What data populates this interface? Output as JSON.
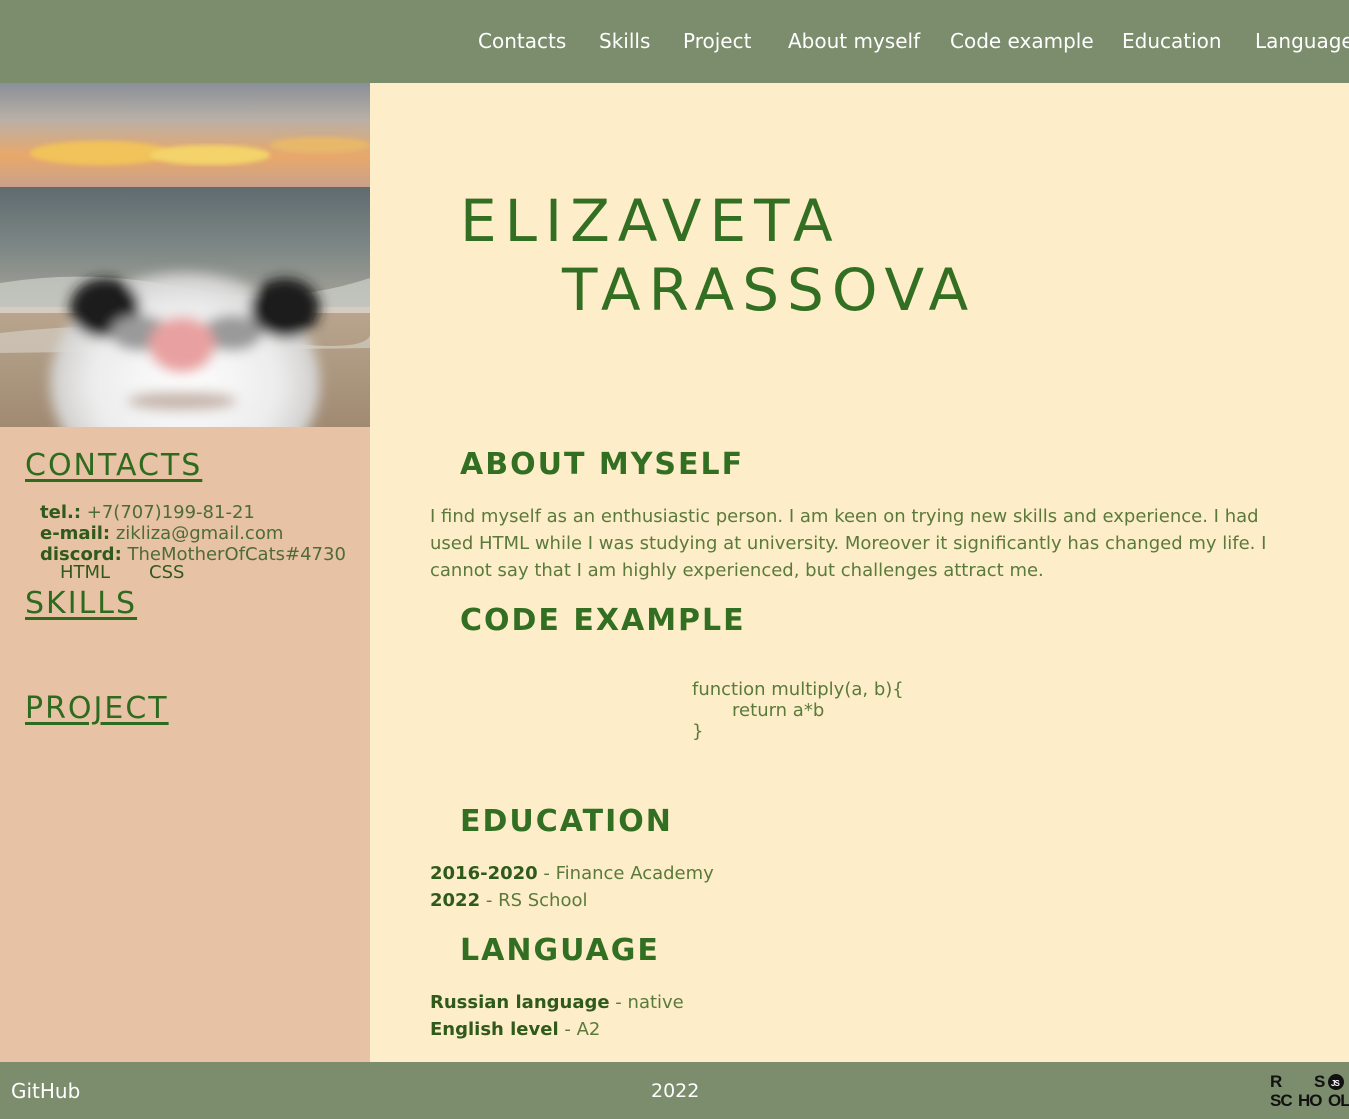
{
  "nav": {
    "items": [
      "Contacts",
      "Skills",
      "Project",
      "About myself",
      "Code example",
      "Education",
      "Language"
    ]
  },
  "sidebar": {
    "contacts_heading": "CONTACTS",
    "contacts": {
      "tel_label": "tel.:",
      "tel_value": "+7(707)199-81-21",
      "email_label": "e-mail:",
      "email_value": "zikliza@gmail.com",
      "discord_label": "discord:",
      "discord_value": "TheMotherOfCats#4730"
    },
    "skills_heading": "SKILLS",
    "skills": [
      "HTML",
      "CSS"
    ],
    "project_heading": "PROJECT"
  },
  "main": {
    "name_first": "ELIZAVETA",
    "name_last": "TARASSOVA",
    "about_heading": "ABOUT MYSELF",
    "about_text": "I find myself as an enthusiastic person. I am keen on trying new skills and experience. I had used HTML while I was studying at university. Moreover it significantly has changed my life. I cannot say that I am highly experienced, but challenges attract me.",
    "code_heading": "CODE EXAMPLE",
    "code_lines": [
      "function multiply(a, b){",
      "       return a*b",
      "}"
    ],
    "education_heading": "EDUCATION",
    "education": [
      {
        "years": "2016-2020",
        "place": "Finance Academy"
      },
      {
        "years": "2022",
        "place": "RS School"
      }
    ],
    "language_heading": "LANGUAGE",
    "languages": [
      {
        "name": "Russian language",
        "level": "native"
      },
      {
        "name": "English level",
        "level": "A2"
      }
    ],
    "separator": " - "
  },
  "footer": {
    "github": "GitHub",
    "year": "2022",
    "logo_text": "RS SCHOOL JS"
  },
  "colors": {
    "header_bg": "#7b8d6c",
    "sidebar_bg": "#e8c2a5",
    "main_bg": "#fdedc9",
    "heading_green": "#336f22"
  }
}
